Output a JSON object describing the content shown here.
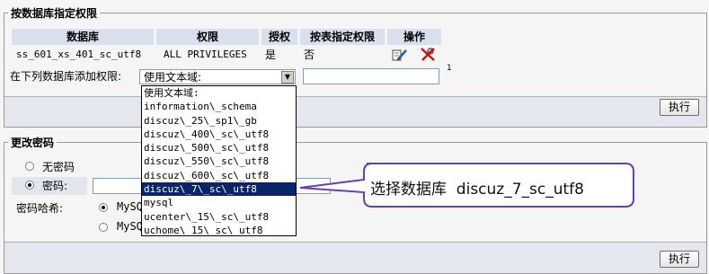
{
  "privileges_section": {
    "legend": "按数据库指定权限",
    "headers": {
      "database": "数据库",
      "privileges": "权限",
      "grant": "授权",
      "table_specific": "按表指定权限",
      "action": "操作"
    },
    "row": {
      "database": "ss_601_xs_401_sc_utf8",
      "privileges": "ALL PRIVILEGES",
      "grant": "是",
      "table_specific": "否"
    },
    "add_label": "在下列数据库添加权限:",
    "select_value": "使用文本域:",
    "footnote": "1",
    "execute_label": "执行"
  },
  "db_options": [
    "使用文本域:",
    "information\\_schema",
    "discuz\\_25\\_sp1\\_gb",
    "discuz\\_400\\_sc\\_utf8",
    "discuz\\_500\\_sc\\_utf8",
    "discuz\\_550\\_sc\\_utf8",
    "discuz\\_600\\_sc\\_utf8",
    "discuz\\_7\\_sc\\_utf8",
    "mysql",
    "ucenter\\_15\\_sc\\_utf8",
    "uchome\\_15\\_sc\\_utf8"
  ],
  "selected_option_index": 7,
  "password_section": {
    "legend": "更改密码",
    "no_password": "无密码",
    "password": "密码:",
    "hash_label": "密码哈希:",
    "hash_option_1": "MySQ",
    "hash_option_2": "MySQ",
    "execute_label": "执行"
  },
  "callout": {
    "text": "选择数据库  discuz_7_sc_utf8",
    "border_color": "#6a3dbb"
  }
}
